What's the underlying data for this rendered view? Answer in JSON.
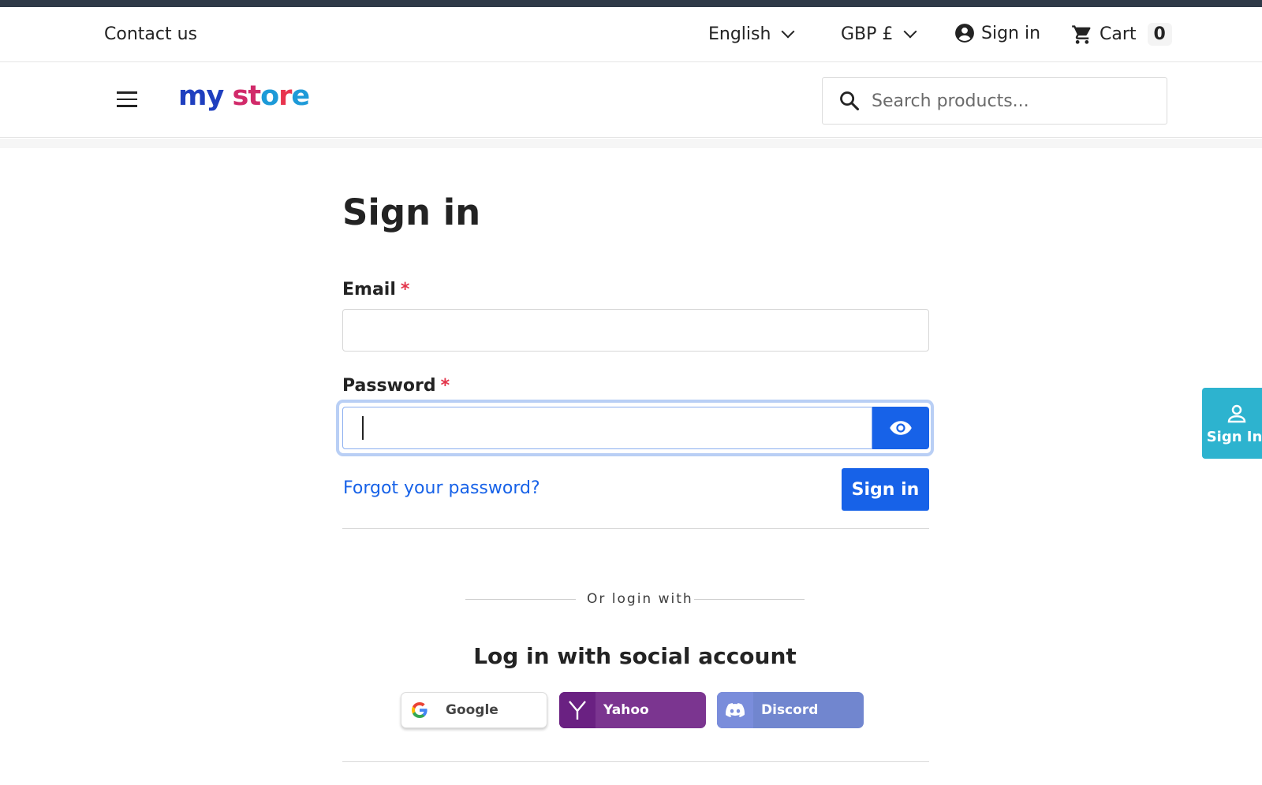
{
  "topbar": {
    "contact": "Contact us",
    "language": "English",
    "currency": "GBP £",
    "sign_in": "Sign in",
    "cart_label": "Cart",
    "cart_count": "0"
  },
  "header": {
    "logo": {
      "part1": "my",
      "part2": "st",
      "part3": "o",
      "part4": "r",
      "part5": "e"
    },
    "search_placeholder": "Search products..."
  },
  "form": {
    "title": "Sign in",
    "email_label": "Email",
    "password_label": "Password",
    "required_mark": "*",
    "forgot": "Forgot your password?",
    "submit": "Sign in"
  },
  "social": {
    "or_text": "Or login with",
    "title": "Log in with social account",
    "providers": [
      {
        "label": "Google",
        "icon": "google-icon"
      },
      {
        "label": "Yahoo",
        "icon": "yahoo-icon"
      },
      {
        "label": "Discord",
        "icon": "discord-icon"
      }
    ]
  },
  "floating": {
    "label": "Sign In",
    "icon": "user-icon"
  },
  "colors": {
    "primary": "#1762e8",
    "required": "#e3344a",
    "floating": "#2db3cf",
    "yahoo": "#7b3590",
    "discord": "#7186cf"
  }
}
